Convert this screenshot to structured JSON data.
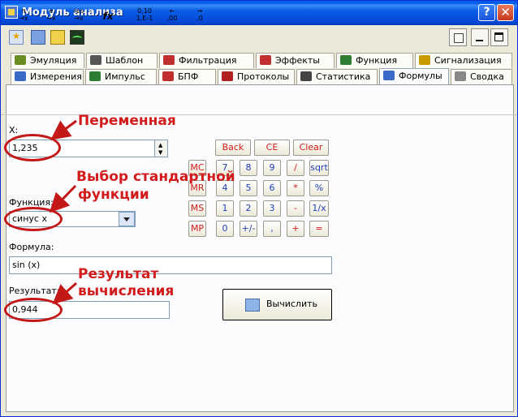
{
  "window": {
    "title": "Модуль анализа"
  },
  "tabs_row1": [
    {
      "label": "Эмуляция",
      "icon": "emulation-icon",
      "color": "#6b8e23"
    },
    {
      "label": "Шаблон",
      "icon": "template-icon",
      "color": "#555555"
    },
    {
      "label": "Фильтрация",
      "icon": "filter-icon",
      "color": "#c03030"
    },
    {
      "label": "Эффекты",
      "icon": "effects-icon",
      "color": "#c03030"
    },
    {
      "label": "Функция",
      "icon": "function-icon",
      "color": "#2e7d32"
    },
    {
      "label": "Сигнализация",
      "icon": "alarm-icon",
      "color": "#c89a00"
    }
  ],
  "tabs_row2": [
    {
      "label": "Измерения",
      "icon": "measure-icon",
      "color": "#3a6ac8"
    },
    {
      "label": "Импульс",
      "icon": "pulse-icon",
      "color": "#2e7d32"
    },
    {
      "label": "БПФ",
      "icon": "fft-icon",
      "color": "#c03030"
    },
    {
      "label": "Протоколы",
      "icon": "protocols-icon",
      "color": "#b22222"
    },
    {
      "label": "Статистика",
      "icon": "statistics-icon",
      "color": "#444444"
    },
    {
      "label": "Формулы",
      "icon": "formulas-icon",
      "color": "#3a6ac8",
      "active": true
    },
    {
      "label": "Сводка",
      "icon": "summary-icon",
      "color": "#666666"
    }
  ],
  "subtoolbar": {
    "btn1": {
      "top": "π",
      "bottom": "→x"
    },
    "btn2": {
      "top": "e",
      "bottom": "→x"
    },
    "btn3": {
      "top": "res",
      "bottom": "→x"
    },
    "btn4": {
      "label": "fx"
    },
    "btn5": {
      "top": "0,10",
      "bottom": "1,E-1"
    },
    "btn6": {
      "top": "←",
      "bottom": ",00"
    },
    "btn7": {
      "top": "→",
      "bottom": ",0"
    }
  },
  "x_field": {
    "label": "X:",
    "value": "1,235"
  },
  "function_field": {
    "label": "Функция:",
    "value": "синус x"
  },
  "formula_field": {
    "label": "Формула:",
    "value": "sin (x)"
  },
  "result_field": {
    "label": "Результат:",
    "value": "0,944"
  },
  "calculator": {
    "back": "Back",
    "ce": "CE",
    "clear": "Clear",
    "memory": [
      "MC",
      "MR",
      "MS",
      "MP"
    ],
    "rows": [
      [
        "7",
        "8",
        "9",
        "/",
        "sqrt"
      ],
      [
        "4",
        "5",
        "6",
        "*",
        "%"
      ],
      [
        "1",
        "2",
        "3",
        "-",
        "1/x"
      ],
      [
        "0",
        "+/-",
        ",",
        "+",
        "="
      ]
    ]
  },
  "calculate_button": {
    "label": "Вычислить"
  },
  "annotations": {
    "variable": "Переменная",
    "function_line1": "Выбор стандартной",
    "function_line2": "функции",
    "result_line1": "Результат",
    "result_line2": "вычисления"
  }
}
